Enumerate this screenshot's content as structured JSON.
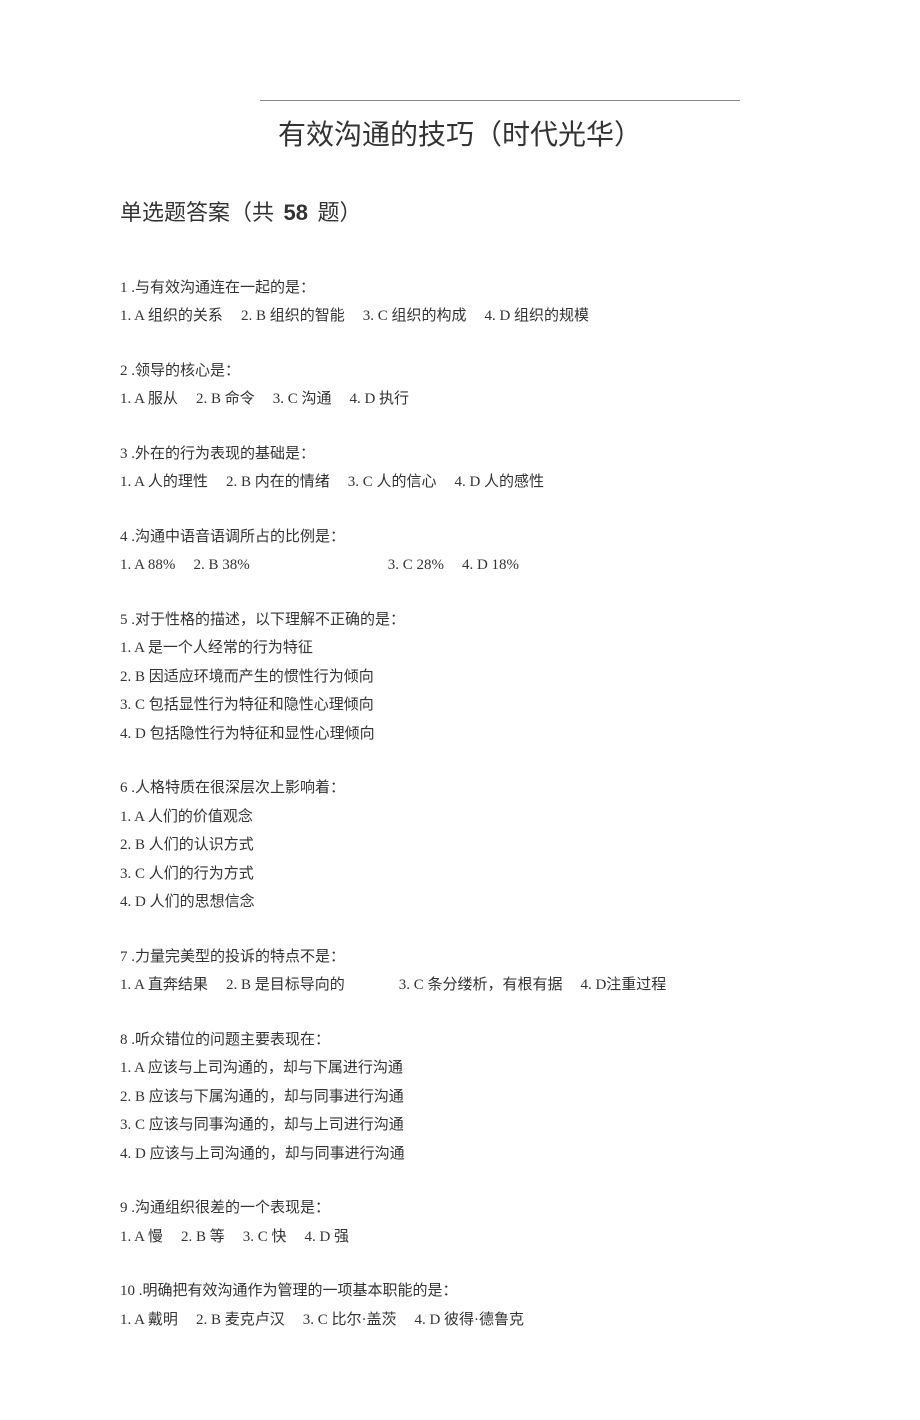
{
  "header": {
    "title": "有效沟通的技巧（时代光华）"
  },
  "section": {
    "prefix": "单选题答案（共",
    "count": "58",
    "suffix": "题）"
  },
  "questions": [
    {
      "text": "1 .与有效沟通连在一起的是：",
      "layout": "inline",
      "options": [
        "1.  A 组织的关系",
        "2. B 组织的智能",
        "3. C 组织的构成",
        "4. D 组织的规模"
      ]
    },
    {
      "text": "2 .领导的核心是：",
      "layout": "inline",
      "options": [
        "1.  A 服从",
        "2. B 命令",
        "3. C 沟通",
        "4. D 执行"
      ]
    },
    {
      "text": "3 .外在的行为表现的基础是：",
      "layout": "inline",
      "options": [
        "1.  A 人的理性",
        "2. B 内在的情绪",
        "3. C 人的信心",
        "4. D 人的感性"
      ]
    },
    {
      "text": "4 .沟通中语音语调所占的比例是：",
      "layout": "inline",
      "options": [
        "1.   A 88%",
        "2. B 38%",
        "3. C 28%",
        "4. D 18%"
      ]
    },
    {
      "text": "5 .对于性格的描述，以下理解不正确的是：",
      "layout": "block",
      "options": [
        "1.   A 是一个人经常的行为特征",
        "2.   B 因适应环境而产生的惯性行为倾向",
        "3.   C 包括显性行为特征和隐性心理倾向",
        "4.   D 包括隐性行为特征和显性心理倾向"
      ]
    },
    {
      "text": "6 .人格特质在很深层次上影响着：",
      "layout": "block",
      "options": [
        "1.   A 人们的价值观念",
        "2.   B 人们的认识方式",
        "3.   C 人们的行为方式",
        "4.   D 人们的思想信念"
      ]
    },
    {
      "text": "7 .力量完美型的投诉的特点不是：",
      "layout": "inline",
      "options": [
        "1.   A 直奔结果",
        "2. B 是目标导向的",
        "3. C 条分缕析，有根有据",
        "4. D注重过程"
      ]
    },
    {
      "text": "8 .听众错位的问题主要表现在：",
      "layout": "block",
      "options": [
        "1.   A 应该与上司沟通的，却与下属进行沟通",
        "2.   B 应该与下属沟通的，却与同事进行沟通",
        "3.   C 应该与同事沟通的，却与上司进行沟通",
        "4.   D 应该与上司沟通的，却与同事进行沟通"
      ]
    },
    {
      "text": "9 .沟通组织很差的一个表现是：",
      "layout": "inline",
      "options": [
        "1.  A 慢",
        "2. B 等",
        "3. C 快",
        "4. D 强"
      ]
    },
    {
      "text": "10 .明确把有效沟通作为管理的一项基本职能的是：",
      "layout": "inline",
      "options": [
        "1.  A 戴明",
        "2. B 麦克卢汉",
        "3. C 比尔·盖茨",
        "4. D 彼得·德鲁克"
      ]
    }
  ]
}
